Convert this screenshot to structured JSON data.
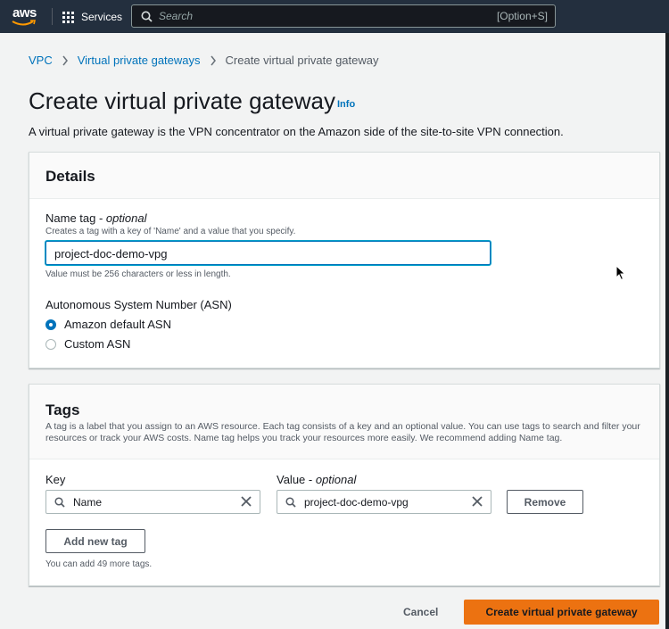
{
  "header": {
    "logo_text": "aws",
    "services_label": "Services",
    "search_placeholder": "Search",
    "search_shortcut": "[Option+S]"
  },
  "breadcrumb": {
    "items": [
      "VPC",
      "Virtual private gateways",
      "Create virtual private gateway"
    ]
  },
  "page": {
    "title": "Create virtual private gateway",
    "info_link": "Info",
    "description": "A virtual private gateway is the VPN concentrator on the Amazon side of the site-to-site VPN connection."
  },
  "details": {
    "title": "Details",
    "name_tag_label": "Name tag - ",
    "name_tag_optional": "optional",
    "name_tag_hint": "Creates a tag with a key of 'Name' and a value that you specify.",
    "name_tag_value": "project-doc-demo-vpg",
    "name_tag_constraint": "Value must be 256 characters or less in length.",
    "asn_label": "Autonomous System Number (ASN)",
    "asn_options": [
      {
        "label": "Amazon default ASN",
        "selected": true
      },
      {
        "label": "Custom ASN",
        "selected": false
      }
    ]
  },
  "tags": {
    "title": "Tags",
    "description": "A tag is a label that you assign to an AWS resource. Each tag consists of a key and an optional value. You can use tags to search and filter your resources or track your AWS costs. Name tag helps you track your resources more easily. We recommend adding Name tag.",
    "key_label": "Key",
    "value_label": "Value - ",
    "value_optional": "optional",
    "rows": [
      {
        "key": "Name",
        "value": "project-doc-demo-vpg",
        "remove_label": "Remove"
      }
    ],
    "add_button": "Add new tag",
    "remaining": "You can add 49 more tags."
  },
  "footer": {
    "cancel_label": "Cancel",
    "submit_label": "Create virtual private gateway"
  },
  "colors": {
    "topbar": "#232f3e",
    "link": "#0073bb",
    "primary": "#ec7211"
  }
}
